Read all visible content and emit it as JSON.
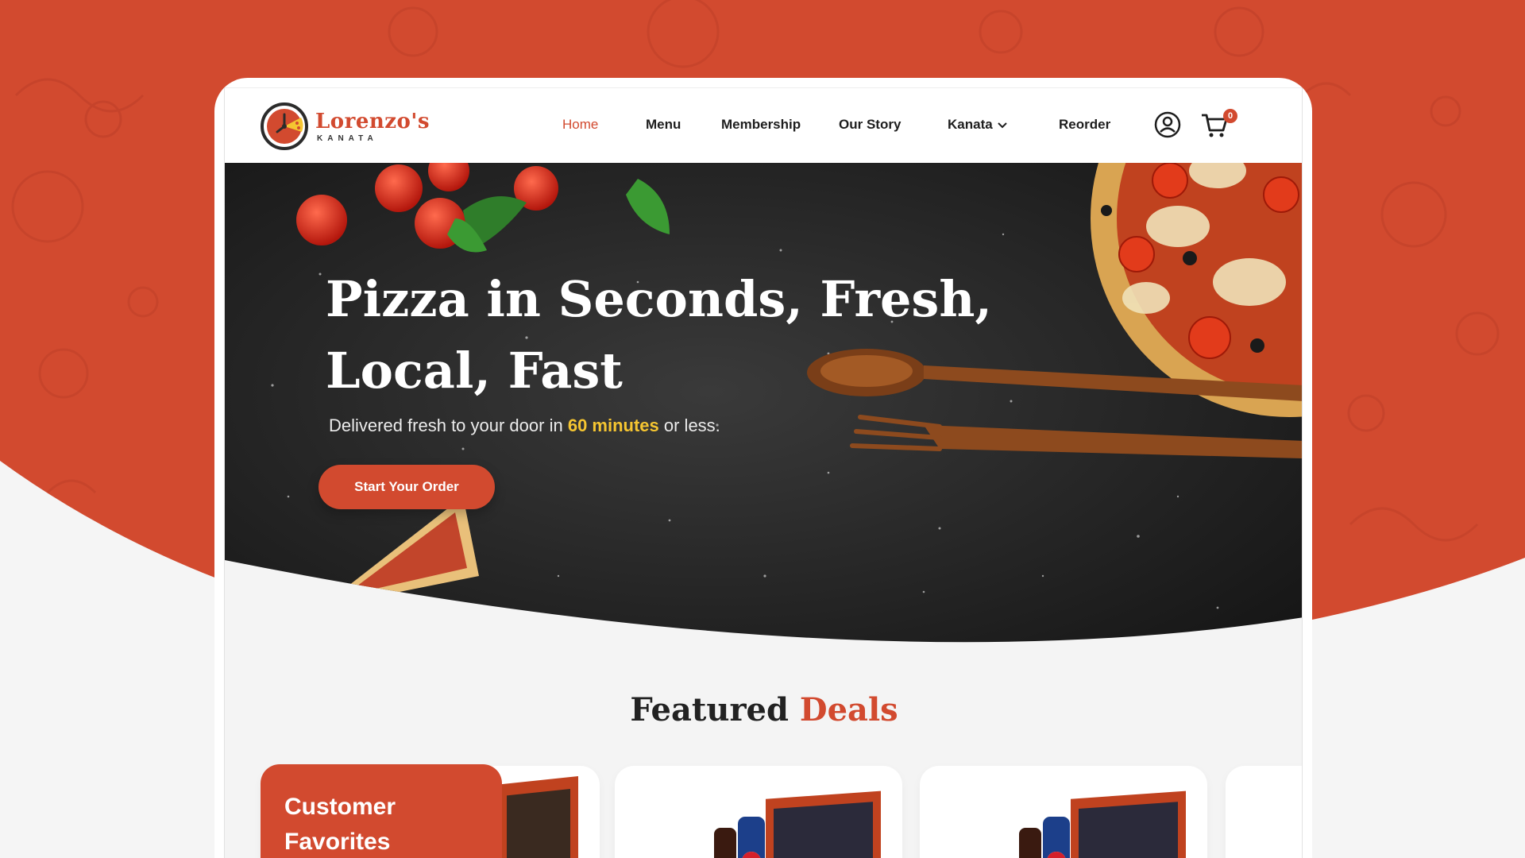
{
  "brand": {
    "name": "Lorenzo's",
    "location": "KANATA",
    "color_primary": "#d24a2f",
    "color_highlight": "#f5c531"
  },
  "nav": {
    "items": [
      {
        "label": "Home",
        "active": true
      },
      {
        "label": "Menu",
        "active": false
      },
      {
        "label": "Membership",
        "active": false
      },
      {
        "label": "Our Story",
        "active": false
      },
      {
        "label": "Kanata",
        "active": false,
        "dropdown": true
      },
      {
        "label": "Reorder",
        "active": false
      }
    ],
    "account_icon": "user-circle-icon",
    "cart_icon": "shopping-cart-icon",
    "cart_count": "0"
  },
  "hero": {
    "title": "Pizza in Seconds, Fresh, Local, Fast",
    "subtitle_before": "Delivered fresh to your door in ",
    "subtitle_highlight": "60 minutes",
    "subtitle_after": " or less.",
    "cta_label": "Start Your Order"
  },
  "featured": {
    "title_plain": "Featured ",
    "title_accent": "Deals",
    "category_card_label": "Customer Favorites"
  }
}
